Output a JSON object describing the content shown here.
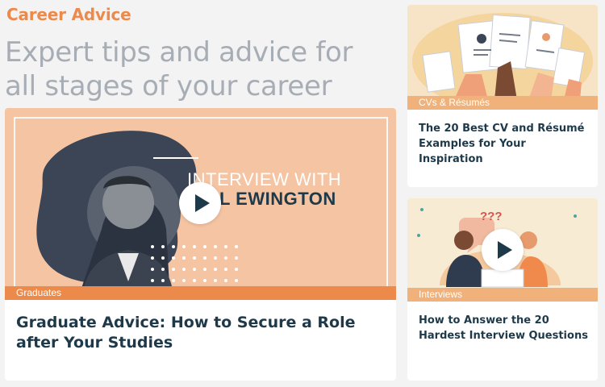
{
  "section": {
    "title": "Career Advice"
  },
  "headline": "Expert tips and advice for all stages of your career",
  "featured": {
    "tag": "Graduates",
    "title": "Graduate Advice: How to Secure a Role after Your Studies",
    "overlay_line1": "INTERVIEW WITH",
    "overlay_line2": "L EWINGTON"
  },
  "side_articles": [
    {
      "tag": "CVs & Résumés",
      "title": "The 20 Best CV and Résumé Examples for Your Inspiration"
    },
    {
      "tag": "Interviews",
      "title": "How to Answer the 20 Hardest Interview Questions",
      "bubble_text": "???"
    }
  ],
  "colors": {
    "accent": "#ec8a4c",
    "heading": "#1e3a4a",
    "muted": "#a7adb5"
  }
}
